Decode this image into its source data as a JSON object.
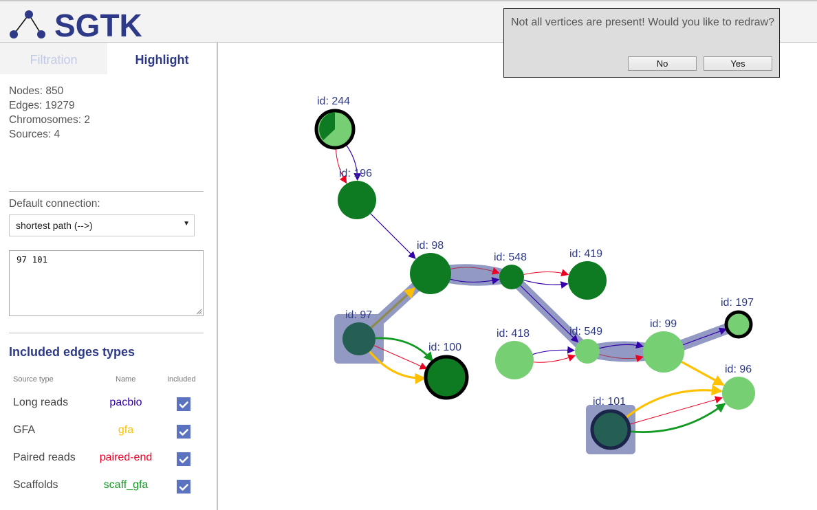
{
  "app": {
    "title": "SGTK"
  },
  "tabs": [
    {
      "label": "Filtration",
      "active": false
    },
    {
      "label": "Highlight",
      "active": true
    }
  ],
  "stats": {
    "nodes": "Nodes: 850",
    "edges": "Edges: 19279",
    "chromosomes": "Chromosomes: 2",
    "sources": "Sources: 4"
  },
  "connection": {
    "label": "Default connection:",
    "selected": "shortest path (-->)"
  },
  "vertices_input": {
    "value": "97 101"
  },
  "edge_types": {
    "title": "Included edges types",
    "headers": {
      "source_type": "Source type",
      "name": "Name",
      "included": "Included"
    },
    "rows": [
      {
        "source_type": "Long reads",
        "name": "pacbio",
        "color": "#3300aa",
        "included": true
      },
      {
        "source_type": "GFA",
        "name": "gfa",
        "color": "#ffc000",
        "included": true
      },
      {
        "source_type": "Paired reads",
        "name": "paired-end",
        "color": "#ee0022",
        "included": true
      },
      {
        "source_type": "Scaffolds",
        "name": "scaff_gfa",
        "color": "#119922",
        "included": true
      }
    ]
  },
  "dialog": {
    "message": "Not all vertices are present! Would you like to redraw?",
    "no_label": "No",
    "yes_label": "Yes"
  },
  "graph": {
    "colors": {
      "dark_green": "#0e7a22",
      "light_green": "#77cf73",
      "selected": "#255e52",
      "highlight": "#9299c3"
    },
    "nodes": [
      {
        "id": "244",
        "label": "id: 244",
        "fill": "light_green",
        "pie": 0.38,
        "border": true
      },
      {
        "id": "196",
        "label": "id: 196",
        "fill": "dark_green"
      },
      {
        "id": "98",
        "label": "id: 98",
        "fill": "dark_green"
      },
      {
        "id": "548",
        "label": "id: 548",
        "fill": "dark_green"
      },
      {
        "id": "419",
        "label": "id: 419",
        "fill": "dark_green"
      },
      {
        "id": "97",
        "label": "id: 97",
        "fill": "selected",
        "selected": true
      },
      {
        "id": "100",
        "label": "id: 100",
        "fill": "dark_green",
        "border": true
      },
      {
        "id": "418",
        "label": "id: 418",
        "fill": "light_green"
      },
      {
        "id": "549",
        "label": "id: 549",
        "fill": "light_green"
      },
      {
        "id": "99",
        "label": "id: 99",
        "fill": "light_green"
      },
      {
        "id": "197",
        "label": "id: 197",
        "fill": "light_green",
        "border": true
      },
      {
        "id": "96",
        "label": "id: 96",
        "fill": "light_green"
      },
      {
        "id": "101",
        "label": "id: 101",
        "fill": "selected",
        "selected": true,
        "border": true
      }
    ],
    "edges": [
      {
        "from": "244",
        "to": "196",
        "type": "pacbio"
      },
      {
        "from": "244",
        "to": "196",
        "type": "paired-end"
      },
      {
        "from": "196",
        "to": "98",
        "type": "pacbio"
      },
      {
        "from": "97",
        "to": "98",
        "type": "gfa",
        "highlighted": true
      },
      {
        "from": "98",
        "to": "548",
        "type": "paired-end",
        "highlighted": true
      },
      {
        "from": "98",
        "to": "548",
        "type": "pacbio",
        "highlighted": true
      },
      {
        "from": "548",
        "to": "419",
        "type": "paired-end"
      },
      {
        "from": "548",
        "to": "419",
        "type": "pacbio"
      },
      {
        "from": "548",
        "to": "549",
        "type": "pacbio",
        "highlighted": true
      },
      {
        "from": "97",
        "to": "100",
        "type": "scaff_gfa"
      },
      {
        "from": "97",
        "to": "100",
        "type": "paired-end"
      },
      {
        "from": "97",
        "to": "100",
        "type": "gfa"
      },
      {
        "from": "418",
        "to": "549",
        "type": "pacbio"
      },
      {
        "from": "418",
        "to": "549",
        "type": "paired-end"
      },
      {
        "from": "549",
        "to": "99",
        "type": "pacbio",
        "highlighted": true
      },
      {
        "from": "549",
        "to": "99",
        "type": "paired-end",
        "highlighted": true
      },
      {
        "from": "99",
        "to": "197",
        "type": "pacbio",
        "highlighted": true
      },
      {
        "from": "99",
        "to": "96",
        "type": "gfa"
      },
      {
        "from": "101",
        "to": "96",
        "type": "gfa"
      },
      {
        "from": "101",
        "to": "96",
        "type": "paired-end"
      },
      {
        "from": "101",
        "to": "96",
        "type": "scaff_gfa"
      }
    ]
  }
}
